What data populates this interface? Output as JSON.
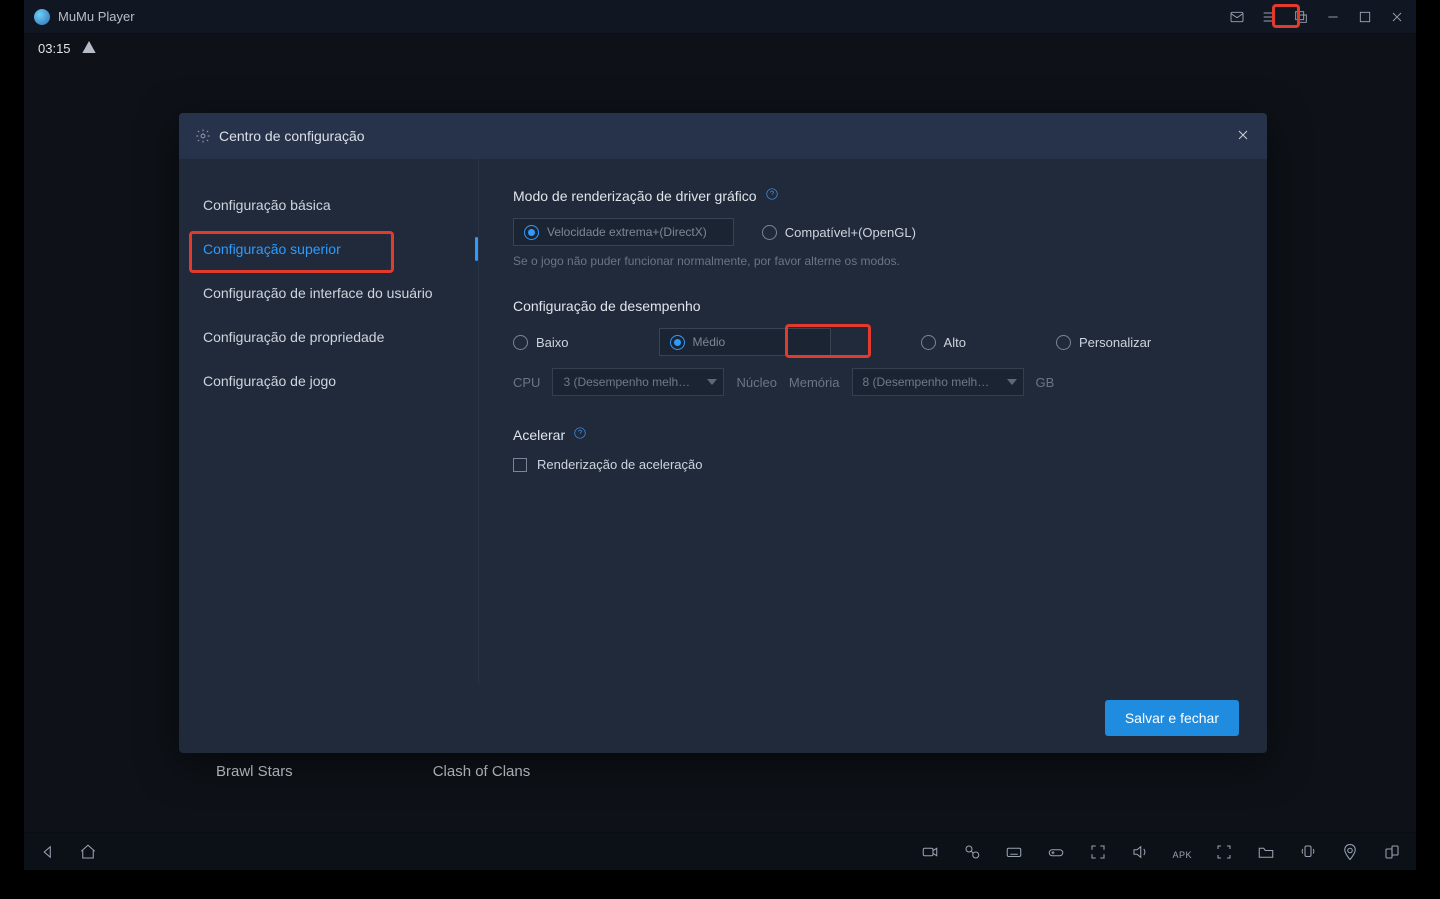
{
  "titlebar": {
    "app_name": "MuMu Player"
  },
  "status": {
    "time": "03:15"
  },
  "bg_apps": {
    "a": "Brawl Stars",
    "b": "Clash of Clans"
  },
  "modal": {
    "title": "Centro de configuração",
    "close_aria": "Fechar",
    "side": {
      "basic": "Configuração básica",
      "superior": "Configuração superior",
      "ui": "Configuração de interface do usuário",
      "property": "Configuração de propriedade",
      "game": "Configuração de jogo"
    },
    "sections": {
      "render": {
        "title": "Modo de renderização de driver gráfico",
        "opt_directx": "Velocidade extrema+(DirectX)",
        "opt_opengl": "Compatível+(OpenGL)",
        "hint": "Se o jogo não puder funcionar normalmente, por favor alterne os modos."
      },
      "perf": {
        "title": "Configuração de desempenho",
        "low": "Baixo",
        "mid": "Médio",
        "high": "Alto",
        "custom": "Personalizar",
        "cpu_label": "CPU",
        "cpu_value": "3 (Desempenho melh…",
        "core_label": "Núcleo",
        "mem_label": "Memória",
        "mem_value": "8 (Desempenho melh…",
        "mem_unit": "GB"
      },
      "accel": {
        "title": "Acelerar",
        "checkbox": "Renderização de aceleração"
      }
    },
    "footer": {
      "save": "Salvar e fechar"
    }
  }
}
